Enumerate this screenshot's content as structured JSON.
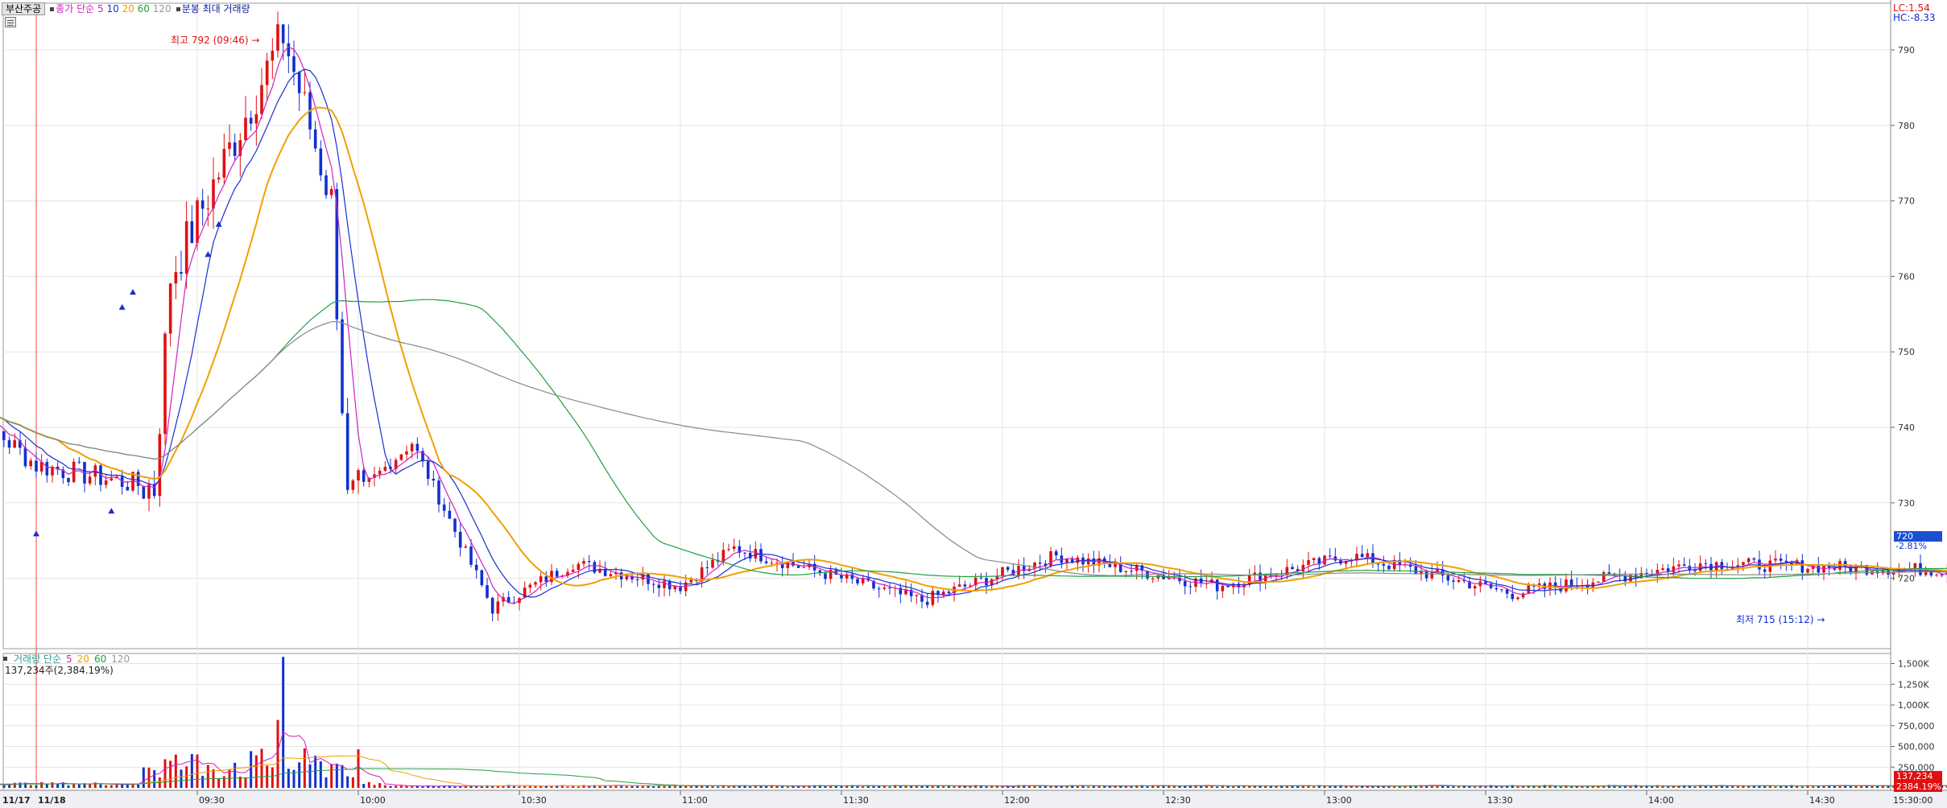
{
  "toolbar": {
    "stock_button": "부산주공",
    "price_ma_label": "종가 단순",
    "ma_periods": [
      "5",
      "10",
      "20",
      "60",
      "120"
    ],
    "minute_label": "분봉 최대 거래량"
  },
  "volume_panel": {
    "legend_label": "거래량 단순",
    "ma_periods": [
      "5",
      "20",
      "60",
      "120"
    ],
    "info": "137,234주(2,384.19%)"
  },
  "price_axis": {
    "ticks": [
      "790",
      "780",
      "770",
      "760",
      "750",
      "740",
      "730",
      "720"
    ]
  },
  "volume_axis": {
    "ticks": [
      "1,500K",
      "1,250K",
      "1,000K",
      "750,000",
      "500,000",
      "250,000"
    ]
  },
  "time_axis": {
    "date_labels": [
      "11/17",
      "11/18"
    ],
    "ticks": [
      "09:30",
      "10:00",
      "10:30",
      "11:00",
      "11:30",
      "12:00",
      "12:30",
      "13:00",
      "13:30",
      "14:00",
      "14:30",
      "15:00"
    ],
    "end_label": "15:30:00"
  },
  "corner": {
    "lc": "LC:1.54",
    "hc": "HC:-8.33"
  },
  "current": {
    "price_badge": "720",
    "change_pct": "-2.81%",
    "volume_badge": "137,234",
    "volume_pct": "2384.19%"
  },
  "annotations": {
    "high": "최고 792 (09:46)",
    "low": "최저 715 (15:12)"
  },
  "colors": {
    "up": "#e01010",
    "down": "#1030d0",
    "ma5": "#d020c0",
    "ma10": "#1a2fd0",
    "ma20": "#f0a000",
    "ma60": "#20a040",
    "ma120": "#888888"
  },
  "chart_data": {
    "type": "candlestick",
    "x_range": [
      "09:00",
      "15:30"
    ],
    "y_range": [
      715,
      792
    ],
    "key_points": [
      {
        "time": "09:00",
        "price": 742
      },
      {
        "time": "09:22",
        "price": 732
      },
      {
        "time": "09:25",
        "price": 760
      },
      {
        "time": "09:46",
        "price": 792
      },
      {
        "time": "09:55",
        "price": 770
      },
      {
        "time": "09:58",
        "price": 730
      },
      {
        "time": "10:10",
        "price": 738
      },
      {
        "time": "10:25",
        "price": 716
      },
      {
        "time": "10:40",
        "price": 722
      },
      {
        "time": "11:00",
        "price": 719
      },
      {
        "time": "11:10",
        "price": 724
      },
      {
        "time": "11:45",
        "price": 717
      },
      {
        "time": "12:10",
        "price": 723
      },
      {
        "time": "12:40",
        "price": 719
      },
      {
        "time": "13:05",
        "price": 723
      },
      {
        "time": "13:35",
        "price": 718
      },
      {
        "time": "14:10",
        "price": 722
      },
      {
        "time": "15:00",
        "price": 721
      },
      {
        "time": "15:12",
        "price": 715
      },
      {
        "time": "15:20",
        "price": 720
      }
    ]
  }
}
